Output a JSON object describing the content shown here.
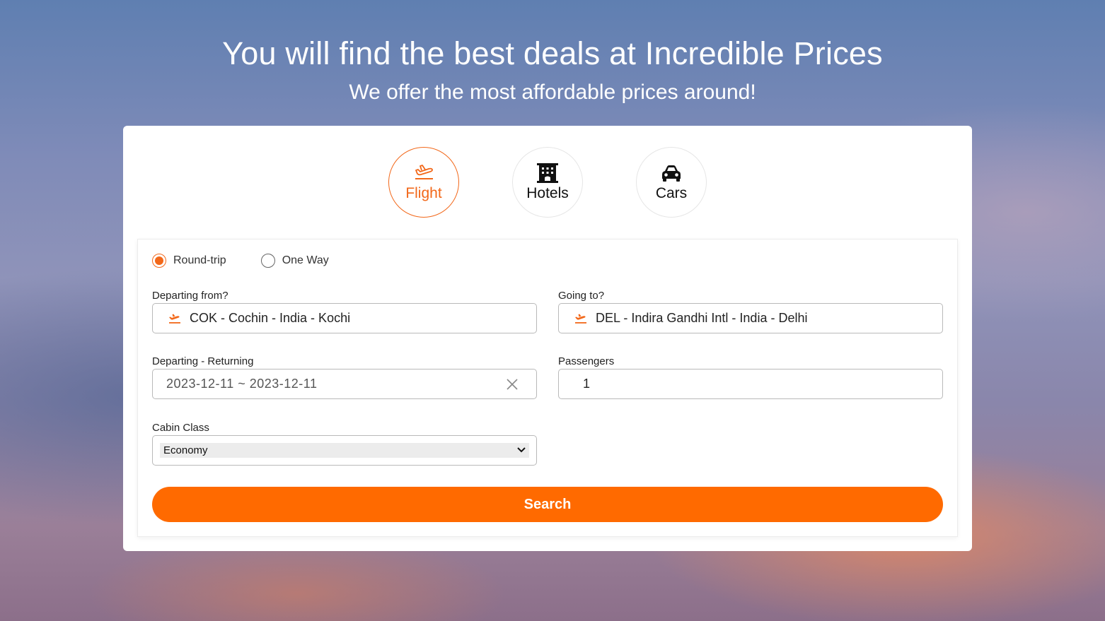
{
  "hero": {
    "title": "You will find the best deals at Incredible Prices",
    "subtitle": "We offer the most affordable prices around!"
  },
  "tabs": [
    {
      "label": "Flight",
      "icon": "plane-departure-icon",
      "active": true
    },
    {
      "label": "Hotels",
      "icon": "building-icon",
      "active": false
    },
    {
      "label": "Cars",
      "icon": "car-icon",
      "active": false
    }
  ],
  "trip_type": {
    "options": [
      {
        "label": "Round-trip",
        "checked": true
      },
      {
        "label": "One Way",
        "checked": false
      }
    ]
  },
  "form": {
    "from_label": "Departing from?",
    "from_value": "COK - Cochin - India - Kochi",
    "to_label": "Going to?",
    "to_value": "DEL - Indira Gandhi Intl - India - Delhi",
    "dates_label": "Departing - Returning",
    "dates_value": "2023-12-11 ~ 2023-12-11",
    "passengers_label": "Passengers",
    "passengers_value": "1",
    "cabin_label": "Cabin Class",
    "cabin_value": "Economy",
    "search_label": "Search"
  },
  "colors": {
    "accent": "#ff6a00",
    "accent_border": "#f2681a",
    "card_bg": "#ffffff"
  }
}
